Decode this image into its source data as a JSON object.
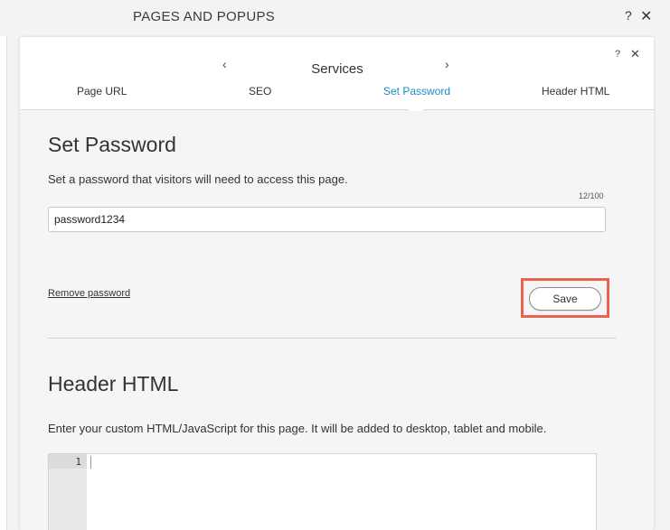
{
  "outer": {
    "title": "PAGES AND POPUPS",
    "help": "?",
    "close": "✕"
  },
  "nav": {
    "help": "?",
    "close": "✕",
    "prev": "‹",
    "next": "›",
    "title": "Services",
    "tabs": [
      {
        "label": "Page URL",
        "active": false
      },
      {
        "label": "SEO",
        "active": false
      },
      {
        "label": "Set Password",
        "active": true
      },
      {
        "label": "Header HTML",
        "active": false
      }
    ]
  },
  "set_password": {
    "title": "Set Password",
    "description": "Set a password that visitors will need to access this page.",
    "counter": "12/100",
    "input_value": "password1234",
    "remove_link": "Remove password",
    "save_label": "Save"
  },
  "header_html": {
    "title": "Header HTML",
    "description": "Enter your custom HTML/JavaScript for this page. It will be added to desktop, tablet and mobile.",
    "line_number": "1",
    "code": ""
  },
  "colors": {
    "accent": "#1a8fc4",
    "highlight": "#e8644f"
  }
}
